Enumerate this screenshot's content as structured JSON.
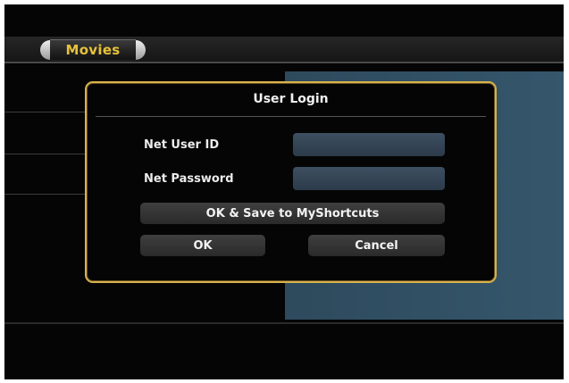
{
  "header": {
    "tab_label": "Movies"
  },
  "dialog": {
    "title": "User Login",
    "fields": [
      {
        "label": "Net User ID",
        "value": "",
        "placeholder": ""
      },
      {
        "label": "Net Password",
        "value": "",
        "placeholder": ""
      }
    ],
    "buttons": {
      "save_shortcut": "OK & Save to MyShortcuts",
      "ok": "OK",
      "cancel": "Cancel"
    }
  },
  "colors": {
    "accent_gold": "#d8b24e",
    "tab_text": "#e7c23a",
    "panel_blue": "#35566b",
    "input_blue": "#3d4f61"
  }
}
